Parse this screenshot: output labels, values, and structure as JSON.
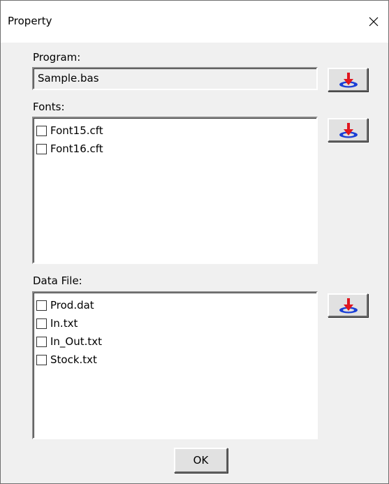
{
  "window": {
    "title": "Property"
  },
  "program": {
    "label": "Program:",
    "value": "Sample.bas"
  },
  "fonts": {
    "label": "Fonts:",
    "items": [
      "Font15.cft",
      "Font16.cft"
    ]
  },
  "data_file": {
    "label": "Data File:",
    "items": [
      "Prod.dat",
      "In.txt",
      "In_Out.txt",
      "Stock.txt"
    ]
  },
  "buttons": {
    "ok_label": "OK",
    "download_icon": "download-to-disk-icon"
  },
  "colors": {
    "dialog_bg": "#f0f0f0",
    "arrow_red": "#e0161f",
    "disk_blue": "#1a3fd6"
  }
}
